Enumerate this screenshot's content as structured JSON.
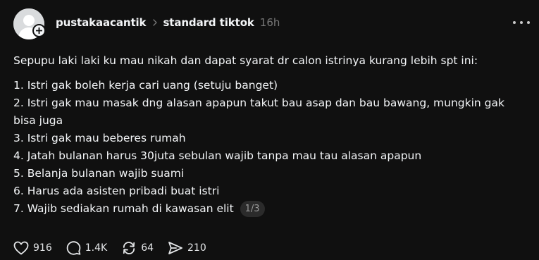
{
  "post": {
    "username": "pustakaacantik",
    "topic": "standard tiktok",
    "time": "16h",
    "intro": "Sepupu laki laki ku mau nikah dan dapat syarat dr calon istrinya kurang lebih spt ini:",
    "items": [
      "1. Istri gak boleh kerja cari uang (setuju banget)",
      "2. Istri gak mau masak dng alasan apapun takut bau asap dan bau bawang, mungkin gak bisa juga",
      "3. Istri gak mau beberes rumah",
      "4. Jatah bulanan harus 30juta sebulan wajib tanpa mau tau alasan apapun",
      "5. Belanja bulanan wajib suami",
      "6. Harus ada asisten pribadi buat istri",
      "7. Wajib sediakan rumah di kawasan elit"
    ],
    "page_indicator": "1/3"
  },
  "actions": {
    "likes": "916",
    "comments": "1.4K",
    "reposts": "64",
    "shares": "210"
  },
  "icons": {
    "avatar": "default-avatar-icon",
    "follow": "plus-icon",
    "separator": "chevron-right-icon",
    "more": "more-dots-icon",
    "like": "heart-icon",
    "comment": "comment-icon",
    "repost": "repost-icon",
    "share": "share-icon"
  },
  "colors": {
    "background": "#101010",
    "text": "#f3f5f7",
    "muted": "#777777"
  }
}
